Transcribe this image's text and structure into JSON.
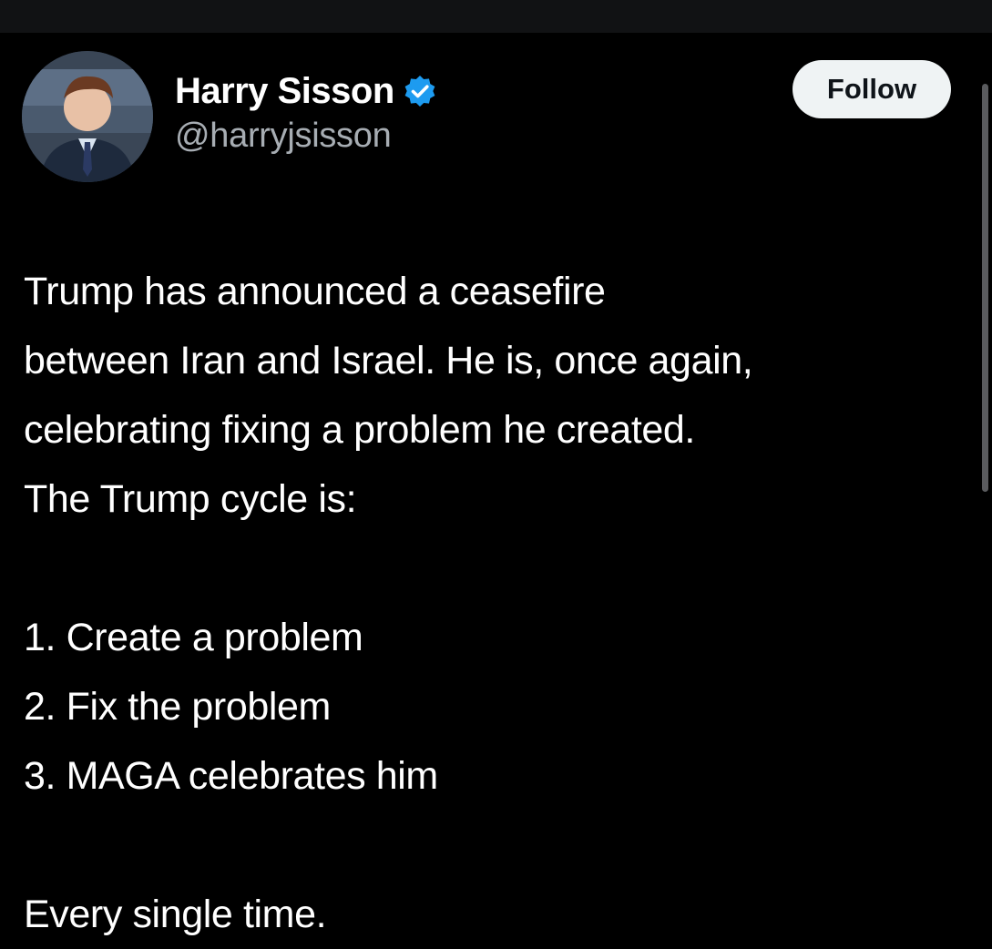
{
  "author": {
    "display_name": "Harry Sisson",
    "handle": "@harryjsisson",
    "verified": true,
    "verified_icon": "verified-badge-icon",
    "avatar_icon": "avatar-photo"
  },
  "actions": {
    "follow_label": "Follow"
  },
  "tweet": {
    "intro_lines": [
      "Trump has announced a ceasefire",
      "between Iran and Israel. He is, once again,",
      "celebrating fixing a problem he created.",
      "The Trump cycle is:"
    ],
    "list_items": [
      "1. Create a problem",
      "2. Fix the problem",
      "3. MAGA celebrates him"
    ],
    "closing": "Every single time."
  },
  "colors": {
    "background": "#000000",
    "text": "#ffffff",
    "handle": "#a7adb3",
    "verified": "#1d9bf0",
    "button_bg": "#eff3f4",
    "button_text": "#0f1419"
  }
}
